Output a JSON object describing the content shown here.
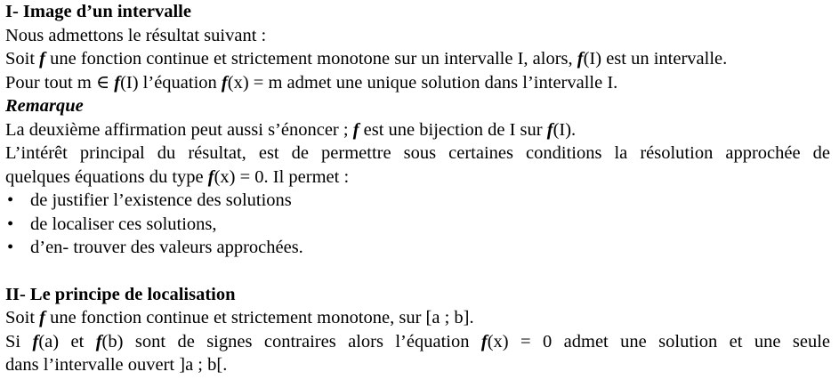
{
  "section1": {
    "title": "I- Image d’un intervalle",
    "intro": "Nous admettons le résultat suivant :",
    "p1": {
      "a": "Soit ",
      "f": "f",
      "b": " une fonction continue et strictement monotone sur un intervalle I, alors, ",
      "f2": "f",
      "c": "(I)  est un intervalle."
    },
    "p2": {
      "a": "Pour tout m ∈ ",
      "f": "f",
      "b": "(I) l’équation ",
      "f2": "f",
      "c": "(x) = m admet une unique solution dans l’intervalle I."
    },
    "remark_title": "Remarque",
    "r1": {
      "a": "La deuxième affirmation peut aussi s’énoncer ; ",
      "f": "f",
      "b": " est une bijection de I sur ",
      "f2": "f",
      "c": "(I)."
    },
    "r2": "L’intérêt principal du résultat, est de permettre sous certaines conditions la résolution approchée de",
    "r3": {
      "a": "quelques équations du type ",
      "f": "f",
      "b": "(x) = 0. Il permet :"
    },
    "bullets": [
      "de justifier l’existence des solutions",
      "de localiser ces solutions,",
      "d’en- trouver des valeurs approchées."
    ]
  },
  "section2": {
    "title": "II- Le principe de localisation",
    "p1": {
      "a": "Soit ",
      "f": "f",
      "b": " une fonction continue et strictement monotone, sur [a ; b]."
    },
    "p2": {
      "a": "Si ",
      "f": "f",
      "b": "(a) et  ",
      "f2": "f",
      "c": "(b) sont de signes contraires alors l’équation ",
      "f3": "f",
      "d": "(x) = 0  admet une solution et une seule"
    },
    "p3": "dans l’intervalle ouvert ]a ; b[."
  }
}
